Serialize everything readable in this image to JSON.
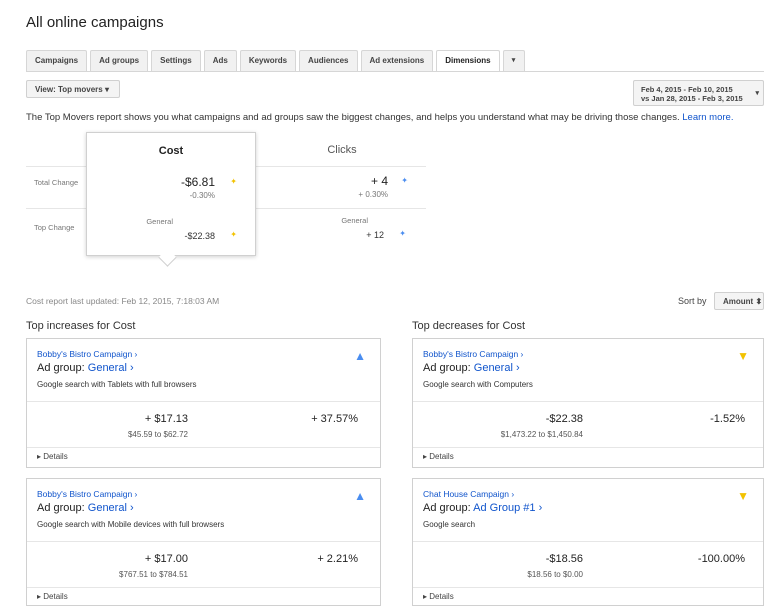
{
  "page_title": "All online campaigns",
  "tabs": [
    "Campaigns",
    "Ad groups",
    "Settings",
    "Ads",
    "Keywords",
    "Audiences",
    "Ad extensions",
    "Dimensions"
  ],
  "active_tab": "Dimensions",
  "tab_more": "▾",
  "view_button": "View: Top movers ▾",
  "date_range": {
    "line1": "Feb 4, 2015 - Feb 10, 2015",
    "line2": "vs Jan 28, 2015 - Feb 3, 2015"
  },
  "intro": {
    "text": "The Top Movers report shows you what campaigns and ad groups saw the biggest changes, and helps you understand what may be driving those changes.",
    "link": "Learn more."
  },
  "summary": {
    "row_labels": [
      "Total Change",
      "Top Change"
    ],
    "cost": {
      "header": "Cost",
      "total": "-$6.81",
      "total_pct": "-0.30%",
      "top_name": "General",
      "top_value": "-$22.38"
    },
    "clicks": {
      "header": "Clicks",
      "total": "+ 4",
      "total_pct": "+ 0.30%",
      "top_name": "General",
      "top_value": "+ 12"
    }
  },
  "updated": "Cost report last updated: Feb 12, 2015, 7:18:03 AM",
  "sort": {
    "label": "Sort by",
    "value": "Amount ⬍"
  },
  "increases": {
    "title": "Top increases for Cost",
    "cards": [
      {
        "campaign": "Bobby's Bistro Campaign ›",
        "adgroup_prefix": "Ad group: ",
        "adgroup": "General ›",
        "desc": "Google search with Tablets with full browsers",
        "amount": "+ $17.13",
        "range": "$45.59 to $62.72",
        "pct": "+ 37.57%",
        "details": "▸ Details"
      },
      {
        "campaign": "Bobby's Bistro Campaign ›",
        "adgroup_prefix": "Ad group: ",
        "adgroup": "General ›",
        "desc": "Google search with Mobile devices with full browsers",
        "amount": "+ $17.00",
        "range": "$767.51 to $784.51",
        "pct": "+ 2.21%",
        "details": "▸ Details"
      }
    ]
  },
  "decreases": {
    "title": "Top decreases for Cost",
    "cards": [
      {
        "campaign": "Bobby's Bistro Campaign ›",
        "adgroup_prefix": "Ad group: ",
        "adgroup": "General ›",
        "desc": "Google search with Computers",
        "amount": "-$22.38",
        "range": "$1,473.22 to $1,450.84",
        "pct": "-1.52%",
        "details": "▸ Details"
      },
      {
        "campaign": "Chat House Campaign ›",
        "adgroup_prefix": "Ad group: ",
        "adgroup": "Ad Group #1 ›",
        "desc": "Google search",
        "amount": "-$18.56",
        "range": "$18.56 to $0.00",
        "pct": "-100.00%",
        "details": "▸ Details"
      }
    ]
  },
  "icons": {
    "up": "arrow-up-icon",
    "down": "arrow-down-icon"
  },
  "colors": {
    "link": "#1155cc",
    "up_arrow": "#4a8df0",
    "down_arrow": "#f2c200"
  }
}
